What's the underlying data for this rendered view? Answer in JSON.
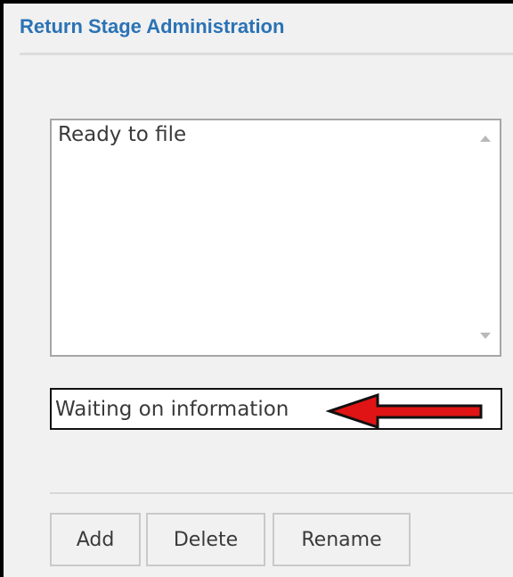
{
  "panel": {
    "title": "Return Stage Administration"
  },
  "stages": {
    "items": [
      "Ready to file"
    ]
  },
  "stage_name_input": {
    "value": "Waiting on information"
  },
  "annotation": {
    "arrow_color": "#e01414",
    "icon": "red-arrow-icon"
  },
  "buttons": {
    "add": "Add",
    "delete": "Delete",
    "rename": "Rename"
  },
  "colors": {
    "title": "#2a73b5",
    "background": "#f1f1f1"
  }
}
